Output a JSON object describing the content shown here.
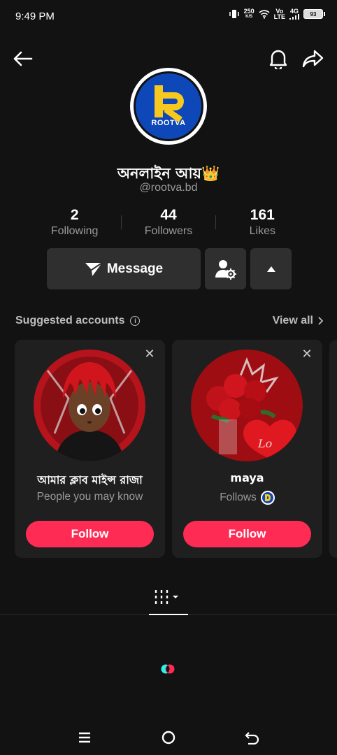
{
  "status_bar": {
    "time": "9:49 PM",
    "speed_value": "250",
    "speed_unit": "K/S",
    "network_top": "Vo",
    "network_bottom": "LTE",
    "signal_label": "4G",
    "battery": "93"
  },
  "icons": {
    "back": "arrow-left-icon",
    "notifications": "bell-icon",
    "share": "share-arrow-icon",
    "message": "paper-plane-icon",
    "add_friend": "person-gear-icon",
    "collapse": "triangle-up-icon",
    "info": "info-icon",
    "close": "close-icon",
    "grid": "grid-icon"
  },
  "profile": {
    "avatar_text": "ROOTVA",
    "name": "অনলাইন আয়👑",
    "handle": "@rootva.bd"
  },
  "stats": [
    {
      "value": "2",
      "label": "Following"
    },
    {
      "value": "44",
      "label": "Followers"
    },
    {
      "value": "161",
      "label": "Likes"
    }
  ],
  "actions": {
    "message_label": "Message"
  },
  "suggested": {
    "title": "Suggested accounts",
    "view_all": "View all",
    "cards": [
      {
        "name": "আমার ক্লাব মাইন্স রাজা",
        "subtitle": "People you may know",
        "follow_label": "Follow"
      },
      {
        "name": "maya",
        "subtitle": "Follows",
        "follow_label": "Follow"
      }
    ]
  },
  "colors": {
    "background": "#121212",
    "accent_follow": "#fe2c55",
    "button_dark": "#2f2f2f",
    "brand_blue": "#0d47b8",
    "brand_yellow": "#f7c81e"
  }
}
